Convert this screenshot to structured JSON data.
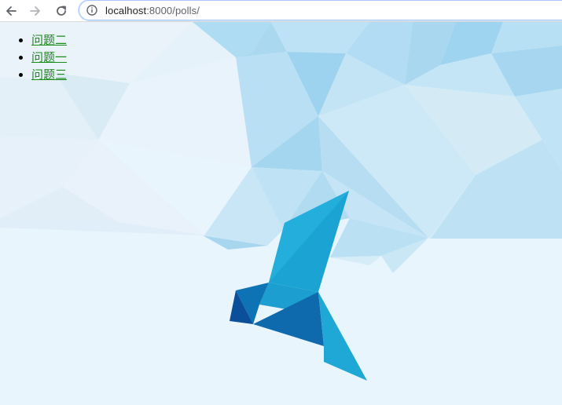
{
  "browser": {
    "back_icon": "arrow-left-icon",
    "forward_icon": "arrow-right-icon",
    "reload_icon": "reload-icon",
    "info_icon": "info-icon",
    "url_host": "localhost",
    "url_rest": ":8000/polls/"
  },
  "polls": {
    "items": [
      {
        "label": "问题二"
      },
      {
        "label": "问题一"
      },
      {
        "label": "问题三"
      }
    ],
    "link_color": "#1a8a1a"
  },
  "background": {
    "sky_color": "#e9f5fc",
    "art": "low-poly-origami-bird"
  }
}
